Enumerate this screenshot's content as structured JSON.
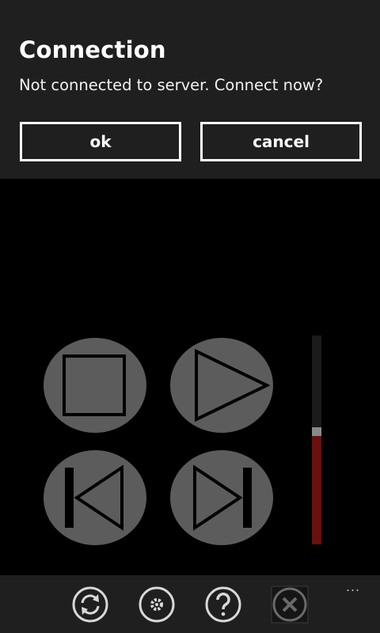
{
  "dialog": {
    "title": "Connection",
    "message": "Not connected to server. Connect now?",
    "ok_label": "ok",
    "cancel_label": "cancel"
  },
  "controls": {
    "stop_icon": "stop-icon",
    "play_icon": "play-icon",
    "previous_icon": "previous-track-icon",
    "next_icon": "next-track-icon"
  },
  "volume": {
    "level": 0.52
  },
  "app_bar": {
    "buttons": [
      "refresh-icon",
      "settings-icon",
      "help-icon",
      "close-icon"
    ],
    "more_label": "..."
  },
  "colors": {
    "dialog_background": "#1f1f1f",
    "control_circle": "#5c5c5c",
    "volume_fill": "#6b0f0f",
    "page_background": "#000000"
  }
}
